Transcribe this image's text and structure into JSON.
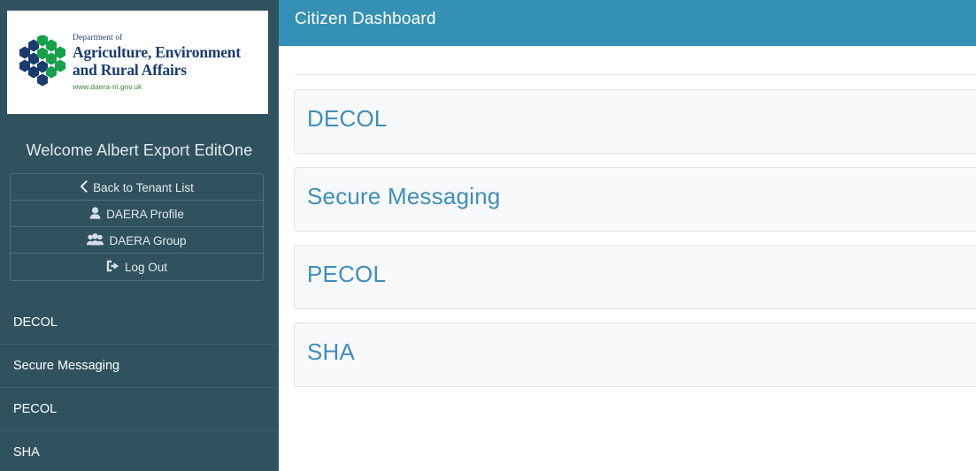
{
  "sidebar": {
    "logo": {
      "department_line": "Department of",
      "title_line1": "Agriculture, Environment",
      "title_line2": "and Rural Affairs",
      "url": "www.daera-ni.gov.uk",
      "icon": "hexagon-cluster-logo",
      "navy": "#1b3b6f",
      "green": "#15a04a"
    },
    "welcome_text": "Welcome Albert Export EditOne",
    "buttons": [
      {
        "label": "Back to Tenant List",
        "icon": "chevron-left-icon"
      },
      {
        "label": "DAERA Profile",
        "icon": "user-icon"
      },
      {
        "label": "DAERA Group",
        "icon": "users-group-icon"
      },
      {
        "label": "Log Out",
        "icon": "sign-out-icon"
      }
    ],
    "nav_items": [
      {
        "label": "DECOL"
      },
      {
        "label": "Secure Messaging"
      },
      {
        "label": "PECOL"
      },
      {
        "label": "SHA"
      }
    ],
    "background_color": "#30525f"
  },
  "header": {
    "title": "Citizen Dashboard",
    "background_color": "#3490b5"
  },
  "main": {
    "cards": [
      {
        "title": "DECOL"
      },
      {
        "title": "Secure Messaging"
      },
      {
        "title": "PECOL"
      },
      {
        "title": "SHA"
      }
    ],
    "card_text_color": "#3e8fba",
    "card_background_color": "#f7f9fa"
  }
}
